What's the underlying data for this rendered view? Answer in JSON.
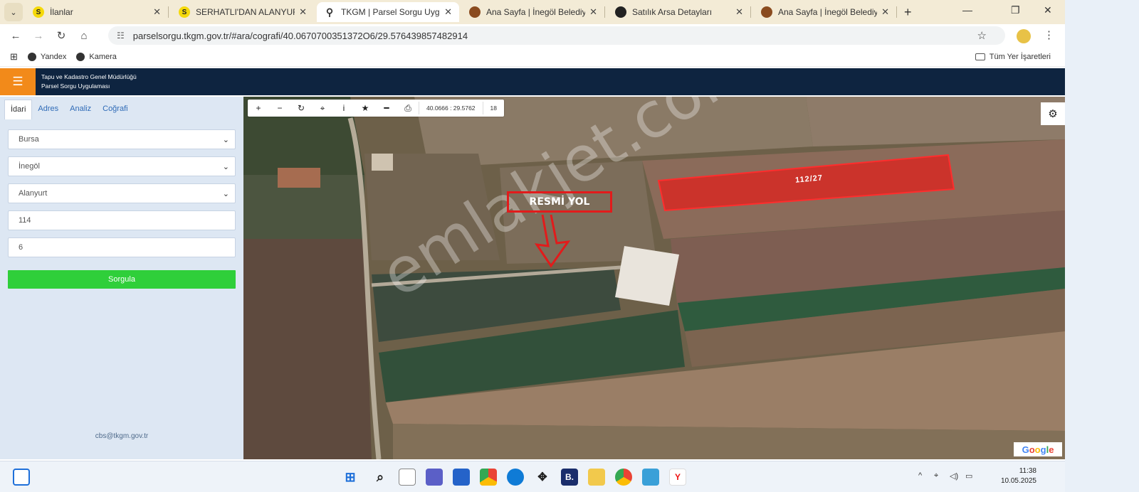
{
  "browser": {
    "tabs": [
      {
        "title": "İlanlar",
        "fav_letter": "S",
        "fav_color": "#f5d90a",
        "active": false
      },
      {
        "title": "SERHATLI'DAN ALANYURT",
        "fav_letter": "S",
        "fav_color": "#f5d90a",
        "active": false
      },
      {
        "title": "TKGM | Parsel Sorgu Uygul",
        "fav_letter": "",
        "fav_color": "#333333",
        "active": true
      },
      {
        "title": "Ana Sayfa | İnegöl Belediye",
        "fav_letter": "",
        "fav_color": "#8a4b1f",
        "active": false
      },
      {
        "title": "Satılık Arsa Detayları",
        "fav_letter": "",
        "fav_color": "#222222",
        "active": false
      },
      {
        "title": "Ana Sayfa | İnegöl Belediye",
        "fav_letter": "",
        "fav_color": "#8a4b1f",
        "active": false
      }
    ],
    "url": "parselsorgu.tkgm.gov.tr/#ara/cografi/40.0670700351372O6/29.576439857482914",
    "bookmarks": [
      "Yandex",
      "Kamera"
    ],
    "all_bookmarks": "Tüm Yer İşaretleri"
  },
  "app": {
    "title_line1": "Tapu ve Kadastro Genel Müdürlüğü",
    "title_line2": "Parsel Sorgu Uygulaması"
  },
  "panel": {
    "tabs": [
      "İdari",
      "Adres",
      "Analiz",
      "Coğrafi"
    ],
    "province": "Bursa",
    "district": "İnegöl",
    "neighborhood": "Alanyurt",
    "block": "114",
    "parcel": "6",
    "query_button": "Sorgula",
    "contact": "cbs@tkgm.gov.tr"
  },
  "map": {
    "coords": "40.0666 : 29.5762",
    "zoom": "18",
    "road_label": "RESMİ YOL",
    "parcel_label": "112/27",
    "watermark": "emlakjet.com",
    "google": "Google",
    "parcel_color": "#e0201c"
  },
  "taskbar": {
    "time": "11:38",
    "date": "10.05.2025"
  }
}
